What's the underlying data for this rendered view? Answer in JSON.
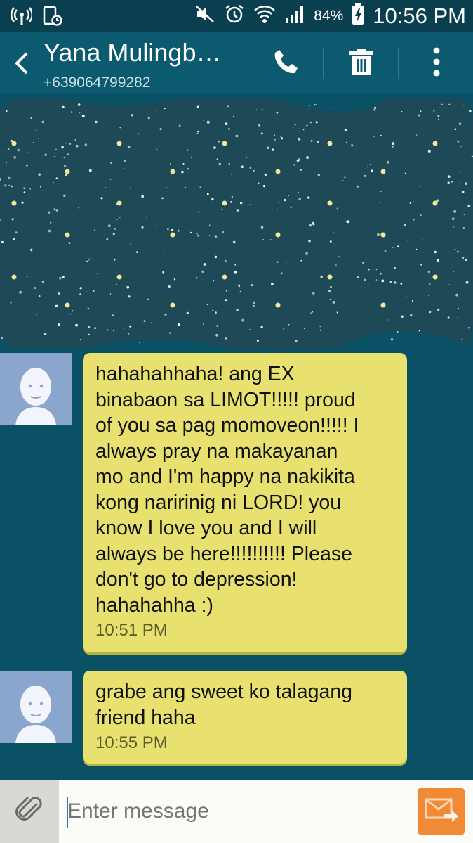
{
  "status_bar": {
    "battery": "84%",
    "time": "10:56 PM"
  },
  "header": {
    "contact_name": "Yana Mulingb…",
    "phone_number": "+639064799282"
  },
  "messages": [
    {
      "text": "hahahahhaha! ang EX\nbinabaon sa LIMOT!!!!! proud\nof you sa pag momoveon!!!!! I\nalways pray na makayanan\nmo and I'm happy na nakikita\nkong naririnig ni LORD! you\nknow I love you and I will\nalways be here!!!!!!!!!! Please\ndon't go to depression!\nhahahahha :)",
      "time": "10:51 PM"
    },
    {
      "text": "grabe ang sweet ko talagang\nfriend haha",
      "time": "10:55 PM"
    }
  ],
  "composer": {
    "placeholder": "Enter message"
  },
  "colors": {
    "background": "#0b5166",
    "app_bar": "#0c5a70",
    "bubble": "#e8e170",
    "send_button": "#f08a34"
  },
  "icons": [
    "wifi-hotspot-icon",
    "screenshot-icon",
    "mute-icon",
    "alarm-icon",
    "wifi-icon",
    "signal-icon",
    "battery-charging-icon",
    "back-arrow-icon",
    "phone-icon",
    "trash-icon",
    "more-vert-icon",
    "paperclip-icon",
    "send-message-icon"
  ]
}
